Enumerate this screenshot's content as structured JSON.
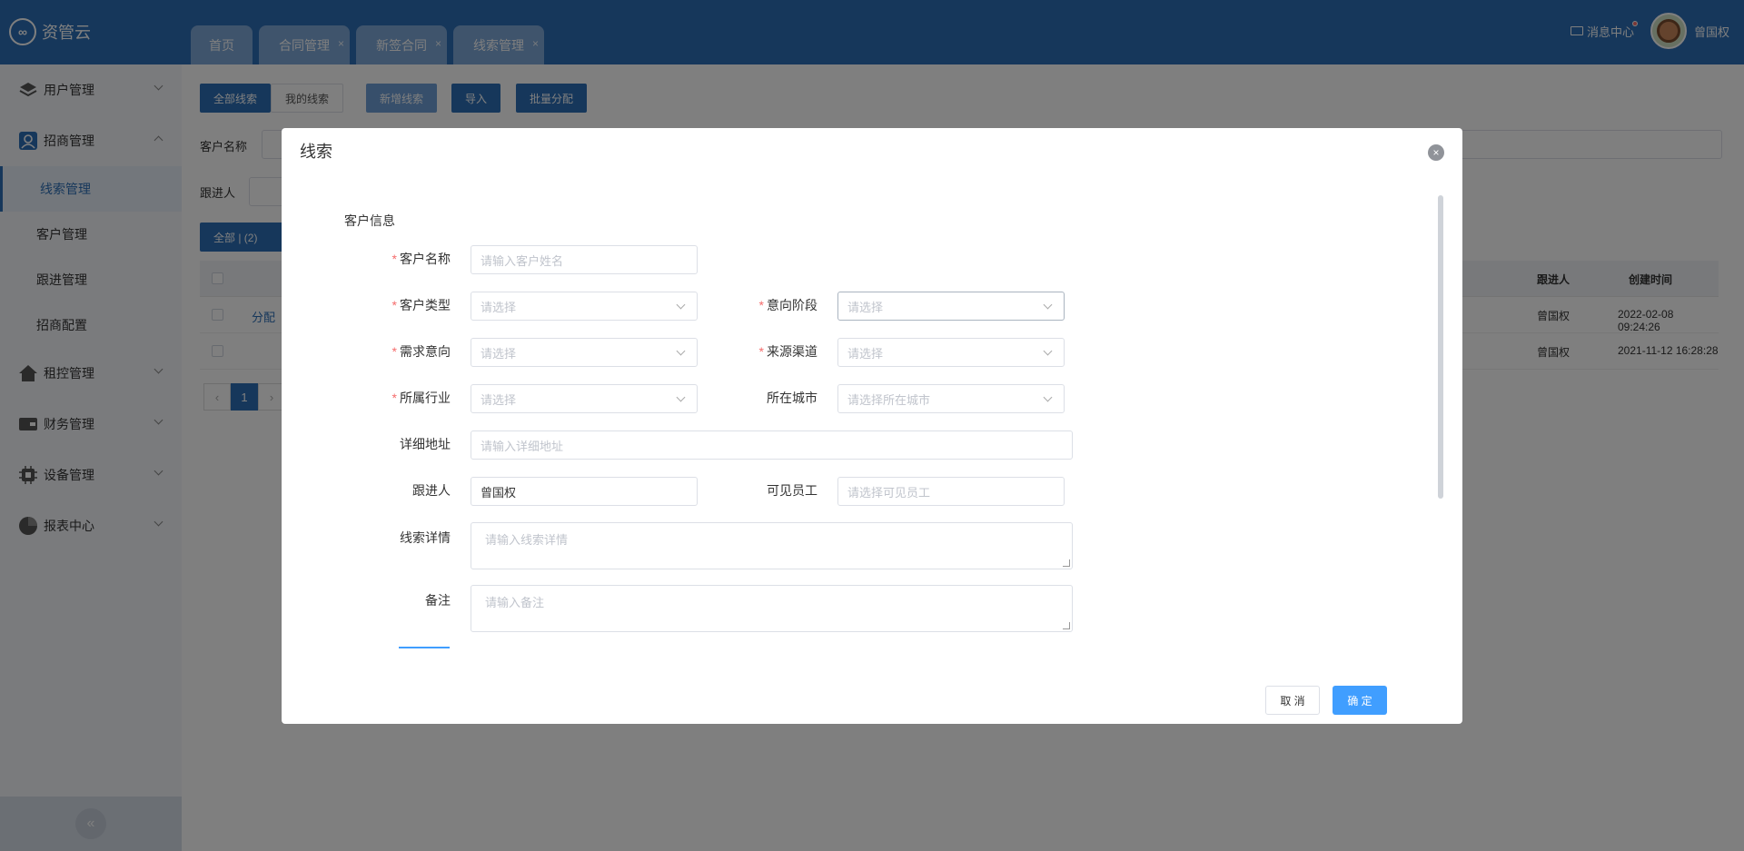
{
  "app": {
    "logo_text": "资管云"
  },
  "tabs": [
    {
      "label": "首页",
      "closable": false
    },
    {
      "label": "合同管理",
      "closable": true
    },
    {
      "label": "新签合同",
      "closable": true
    },
    {
      "label": "线索管理",
      "closable": true
    }
  ],
  "header": {
    "message_center": "消息中心",
    "username": "曾国权",
    "close_glyph": "×"
  },
  "sidebar": {
    "items": [
      {
        "label": "用户管理",
        "icon": "layers-icon"
      },
      {
        "label": "招商管理",
        "icon": "user-card-icon"
      },
      {
        "label": "租控管理",
        "icon": "home-icon"
      },
      {
        "label": "财务管理",
        "icon": "wallet-icon"
      },
      {
        "label": "设备管理",
        "icon": "chip-icon"
      },
      {
        "label": "报表中心",
        "icon": "pie-icon"
      }
    ],
    "sub_items": [
      "线索管理",
      "客户管理",
      "跟进管理",
      "招商配置"
    ],
    "collapse_glyph": "«"
  },
  "toolbar": {
    "all_leads": "全部线索",
    "my_leads": "我的线索",
    "new_lead": "新增线索",
    "import": "导入",
    "batch_assign": "批量分配"
  },
  "filters": {
    "customer_name": "客户名称",
    "follower": "跟进人",
    "all_count": "全部 | (2)"
  },
  "table": {
    "headers": {
      "follower": "跟进人",
      "created": "创建时间"
    },
    "assign": "分配",
    "rows": [
      {
        "follower": "曾国权",
        "created": "2022-02-08 09:24:26"
      },
      {
        "follower": "曾国权",
        "created": "2021-11-12 16:28:28"
      }
    ],
    "page": "1"
  },
  "modal": {
    "title": "线索",
    "close_glyph": "×",
    "section": "客户信息",
    "required_mark": "*",
    "fields": {
      "customer_name": {
        "label": "客户名称",
        "placeholder": "请输入客户姓名"
      },
      "customer_type": {
        "label": "客户类型",
        "placeholder": "请选择"
      },
      "intent_stage": {
        "label": "意向阶段",
        "placeholder": "请选择"
      },
      "demand": {
        "label": "需求意向",
        "placeholder": "请选择"
      },
      "source": {
        "label": "来源渠道",
        "placeholder": "请选择"
      },
      "industry": {
        "label": "所属行业",
        "placeholder": "请选择"
      },
      "city": {
        "label": "所在城市",
        "placeholder": "请选择所在城市"
      },
      "address": {
        "label": "详细地址",
        "placeholder": "请输入详细地址"
      },
      "follower": {
        "label": "跟进人",
        "value": "曾国权"
      },
      "visible_staff": {
        "label": "可见员工",
        "placeholder": "请选择可见员工"
      },
      "lead_detail": {
        "label": "线索详情",
        "placeholder": "请输入线索详情"
      },
      "remark": {
        "label": "备注",
        "placeholder": "请输入备注"
      }
    },
    "cancel": "取 消",
    "confirm": "确 定"
  }
}
